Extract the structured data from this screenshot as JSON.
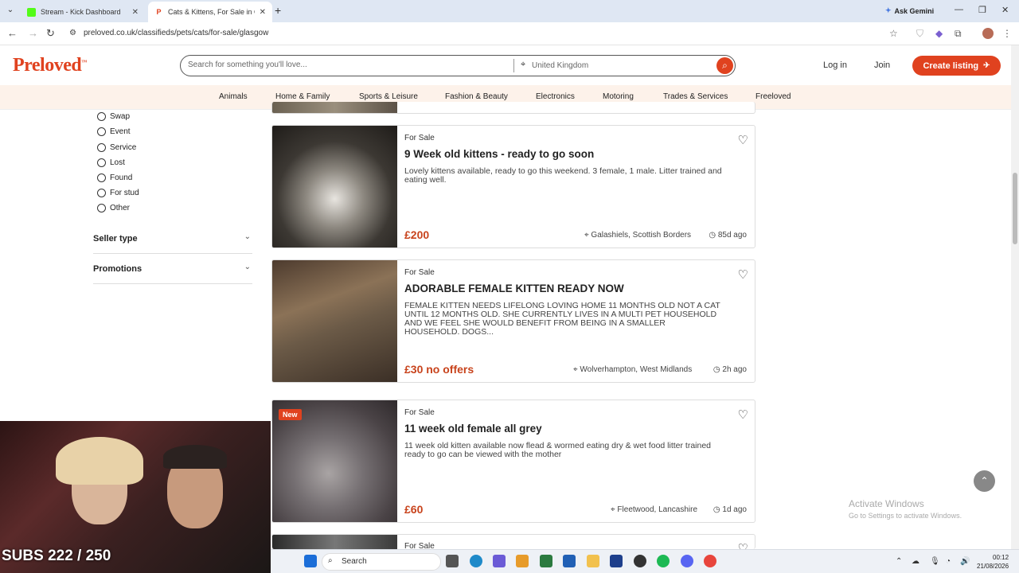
{
  "browser": {
    "tabs": [
      {
        "title": "Stream - Kick Dashboard",
        "active": false
      },
      {
        "title": "Cats & Kittens, For Sale in Glasg",
        "active": true
      }
    ],
    "ask_gemini": "Ask Gemini",
    "url": "preloved.co.uk/classifieds/pets/cats/for-sale/glasgow"
  },
  "site": {
    "logo": "Preloved",
    "search_placeholder": "Search for something you'll love...",
    "location": "United Kingdom",
    "login": "Log in",
    "join": "Join",
    "create_listing": "Create listing"
  },
  "categories": [
    "Animals",
    "Home & Family",
    "Sports & Leisure",
    "Fashion & Beauty",
    "Electronics",
    "Motoring",
    "Trades & Services",
    "Freeloved"
  ],
  "sidebar": {
    "radio_options": [
      "Swap",
      "Event",
      "Service",
      "Lost",
      "Found",
      "For stud",
      "Other"
    ],
    "filters": [
      "Seller type",
      "Promotions"
    ]
  },
  "listings": [
    {
      "type": "For Sale",
      "title": "9 Week old kittens - ready to go soon",
      "description": "Lovely kittens available, ready to go this weekend. 3 female, 1 male. Litter trained and eating well.",
      "price": "£200",
      "location": "Galashiels, Scottish Borders",
      "age": "85d ago",
      "new": false
    },
    {
      "type": "For Sale",
      "title": "ADORABLE FEMALE KITTEN READY NOW",
      "description": "FEMALE KITTEN NEEDS LIFELONG LOVING HOME 11 MONTHS OLD NOT A CAT UNTIL 12 MONTHS OLD. SHE CURRENTLY LIVES IN A MULTI PET HOUSEHOLD AND WE FEEL SHE WOULD BENEFIT FROM BEING IN A SMALLER HOUSEHOLD. DOGS...",
      "price": "£30 no offers",
      "location": "Wolverhampton, West Midlands",
      "age": "2h ago",
      "new": false
    },
    {
      "type": "For Sale",
      "title": "11 week old female all grey",
      "description": "11 week old kitten available now flead & wormed eating dry & wet food litter trained ready to go can be viewed with the mother",
      "price": "£60",
      "location": "Fleetwood, Lancashire",
      "age": "1d ago",
      "new": true,
      "badge": "New"
    },
    {
      "type": "For Sale"
    }
  ],
  "windows_notice": {
    "line1": "Activate Windows",
    "line2": "Go to Settings to activate Windows."
  },
  "stream_overlay": {
    "subs": "SUBS 222 / 250"
  },
  "taskbar": {
    "search": "Search",
    "time": "00:12",
    "date": "21/08/2026"
  },
  "colors": {
    "brand": "#e0421f",
    "price": "#c8431c",
    "nav_bg": "#fdf2ea"
  }
}
